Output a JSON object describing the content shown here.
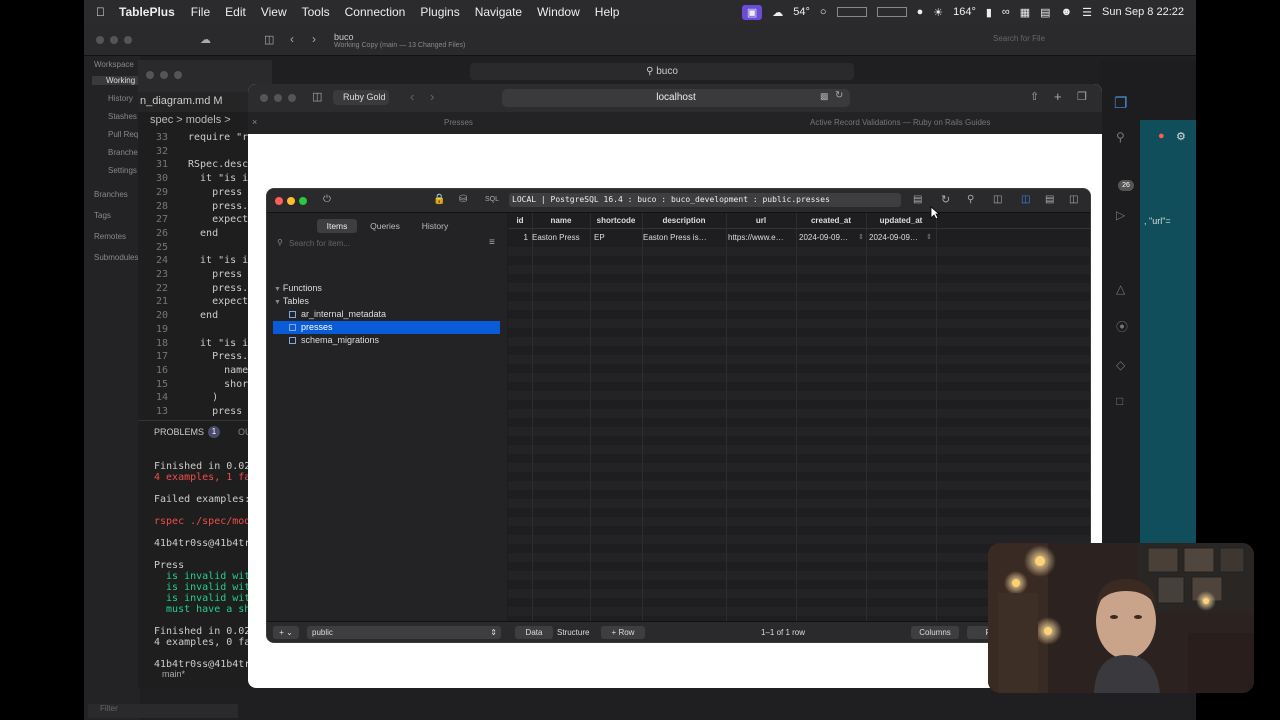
{
  "menubar": {
    "app_name": "TablePlus",
    "items": [
      "File",
      "Edit",
      "View",
      "Tools",
      "Connection",
      "Plugins",
      "Navigate",
      "Window",
      "Help"
    ],
    "weather": "54°",
    "temp": "164°",
    "datetime": "Sun Sep 8  22:22"
  },
  "git": {
    "title": "buco",
    "subtitle": "Working Copy (main — 13 Changed Files)",
    "search_placeholder": "Search for File",
    "sidebar": [
      "Workspace",
      "Working",
      "History",
      "Stashes",
      "Pull Req",
      "Branches",
      "Settings",
      "Branches",
      "Tags",
      "Remotes",
      "Submodules"
    ],
    "filter_placeholder": "Filter"
  },
  "editor": {
    "file_tab": "n_diagram.md  M",
    "breadcrumb": "spec > models >",
    "lines": [
      {
        "n": "33",
        "t": "require \"r"
      },
      {
        "n": "32",
        "t": ""
      },
      {
        "n": "31",
        "t": "RSpec.desc"
      },
      {
        "n": "30",
        "t": "  it \"is i"
      },
      {
        "n": "29",
        "t": "    press ="
      },
      {
        "n": "28",
        "t": "    press."
      },
      {
        "n": "27",
        "t": "    expect"
      },
      {
        "n": "26",
        "t": "  end"
      },
      {
        "n": "25",
        "t": ""
      },
      {
        "n": "24",
        "t": "  it \"is i"
      },
      {
        "n": "23",
        "t": "    press ="
      },
      {
        "n": "22",
        "t": "    press."
      },
      {
        "n": "21",
        "t": "    expect"
      },
      {
        "n": "20",
        "t": "  end"
      },
      {
        "n": "19",
        "t": ""
      },
      {
        "n": "18",
        "t": "  it \"is i"
      },
      {
        "n": "17",
        "t": "    Press."
      },
      {
        "n": "16",
        "t": "      name"
      },
      {
        "n": "15",
        "t": "      short"
      },
      {
        "n": "14",
        "t": "    )"
      },
      {
        "n": "13",
        "t": "    press ="
      }
    ],
    "panel_tabs": [
      "PROBLEMS",
      "1",
      "OU"
    ],
    "terminal": [
      "Finished in 0.029",
      "4 examples, 1 fai",
      "",
      "Failed examples:",
      "",
      "rspec ./spec/mode",
      "",
      "41b4tr0ss@41b4tr0",
      "",
      "Press",
      "  is invalid with",
      "  is invalid with",
      "  is invalid with",
      "  must have a sho",
      "",
      "Finished in 0.025",
      "4 examples, 0 fai",
      "",
      "41b4tr0ss@41b4tr0"
    ],
    "status": "main*"
  },
  "browser": {
    "profile": "Ruby Gold",
    "url": "localhost",
    "back_search": "buco",
    "tabs": [
      "Presses",
      "Active Record Validations — Ruby on Rails Guides"
    ]
  },
  "tableplus": {
    "connection": "LOCAL | PostgreSQL 16.4 : buco : buco_development : public.presses",
    "sidebar_tabs": [
      "Items",
      "Queries",
      "History"
    ],
    "search_placeholder": "Search for item...",
    "tree": {
      "functions": "Functions",
      "tables": "Tables",
      "items": [
        "ar_internal_metadata",
        "presses",
        "schema_migrations"
      ],
      "selected": "presses"
    },
    "columns": [
      "id",
      "name",
      "shortcode",
      "description",
      "url",
      "created_at",
      "updated_at"
    ],
    "rows": [
      [
        "1",
        "Easton Press",
        "EP",
        "Easton Press is…",
        "https://www.e…",
        "2024-09-09…",
        "2024-09-09…"
      ]
    ],
    "schema": "public",
    "bottom": {
      "data": "Data",
      "structure": "Structure",
      "row": "Row",
      "count": "1–1 of 1 row",
      "columns": "Columns",
      "filter": "Fi"
    },
    "traffic_colors": [
      "#ff5f57",
      "#febc2e",
      "#28c840"
    ],
    "selection_color": "#0a5bd8"
  },
  "badge": "26"
}
